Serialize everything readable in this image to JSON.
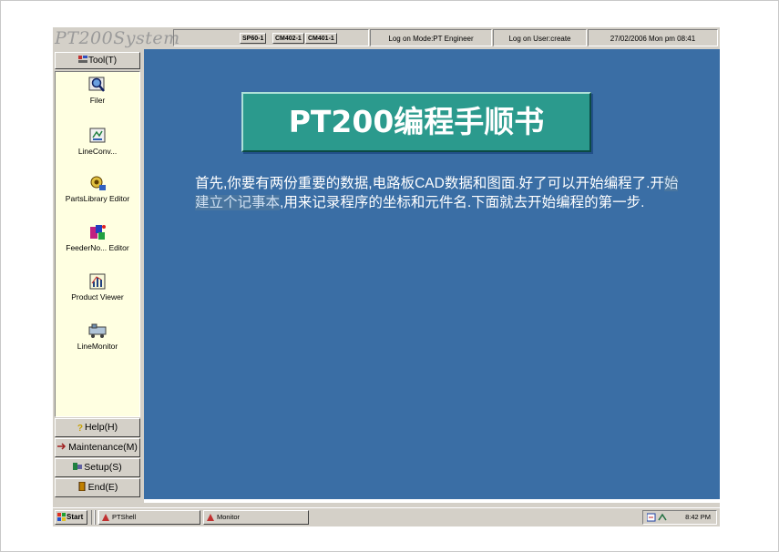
{
  "app": {
    "logo": "PT200System"
  },
  "status": {
    "modules": [
      "SP60-1",
      "CM402-1",
      "CM401-1"
    ],
    "logon_mode": "Log on Mode:PT Engineer",
    "logon_user": "Log on User:create",
    "datetime": "27/02/2006 Mon pm 08:41"
  },
  "sidebar": {
    "tool_button": "Tool(T)",
    "tools": [
      {
        "label": "Filer",
        "icon": "filer-icon"
      },
      {
        "label": "LineConv...",
        "icon": "line-conv-icon"
      },
      {
        "label": "PartsLibrary Editor",
        "icon": "parts-library-icon"
      },
      {
        "label": "FeederNo... Editor",
        "icon": "feeder-editor-icon"
      },
      {
        "label": "Product Viewer",
        "icon": "product-viewer-icon"
      },
      {
        "label": "LineMonitor",
        "icon": "line-monitor-icon"
      }
    ],
    "bottom_buttons": [
      {
        "label": "Help(H)",
        "icon": "help-icon"
      },
      {
        "label": "Maintenance(M)",
        "icon": "maintenance-icon"
      },
      {
        "label": "Setup(S)",
        "icon": "setup-icon"
      },
      {
        "label": "End(E)",
        "icon": "end-icon"
      }
    ]
  },
  "content": {
    "title": "PT200编程手顺书",
    "para_before": "首先,你要有两份重要的数据,电路板CAD数据和图面.好了可以开始编程了.开",
    "para_highlight": "始建立个记事本",
    "para_after": ",用来记录程序的坐标和元件名.下面就去开始编程的第一步."
  },
  "taskbar": {
    "start": "Start",
    "tasks": [
      "PTShell",
      "Monitor"
    ],
    "clock": "8:42 PM"
  },
  "colors": {
    "desktop_blue": "#3a6ea5",
    "title_teal": "#2b9a8d",
    "panel_yellow": "#ffffe1",
    "chrome": "#d4d0c8"
  }
}
